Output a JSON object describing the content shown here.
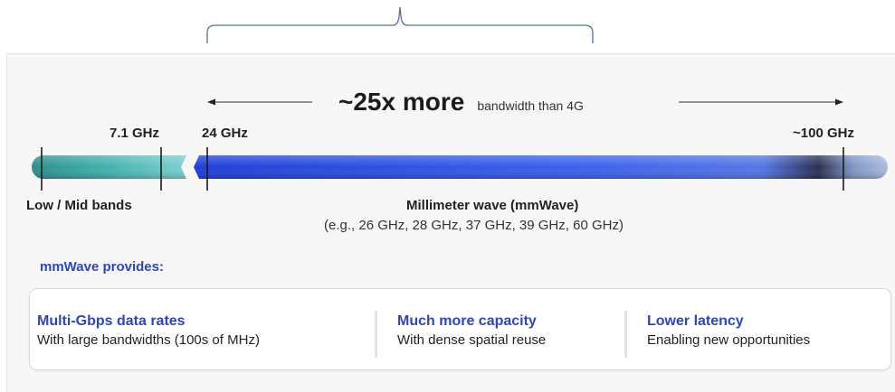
{
  "headline": {
    "multiplier": "~25x more",
    "suffix": "bandwidth than 4G"
  },
  "frequencies": {
    "f1": "7.1 GHz",
    "f2": "24 GHz",
    "f3": "~100 GHz"
  },
  "bands": {
    "low_mid": "Low / Mid bands",
    "mmwave": "Millimeter wave (mmWave)",
    "mmwave_examples": "(e.g., 26 GHz, 28 GHz, 37 GHz, 39 GHz, 60 GHz)"
  },
  "provides_title": "mmWave provides:",
  "features": [
    {
      "title": "Multi-Gbps data rates",
      "desc": "With large bandwidths (100s of MHz)"
    },
    {
      "title": "Much more capacity",
      "desc": "With dense spatial reuse"
    },
    {
      "title": "Lower latency",
      "desc": "Enabling new opportunities"
    }
  ],
  "colors": {
    "accent_blue": "#2c46c2",
    "teal": "#3aa8a8",
    "mmwave_blue": "#2f55e0"
  }
}
